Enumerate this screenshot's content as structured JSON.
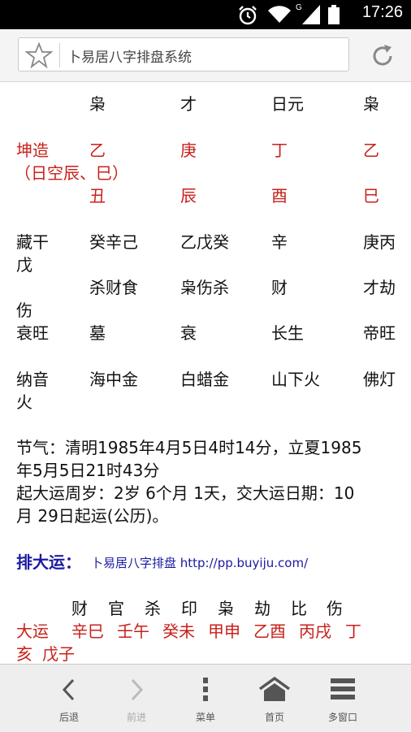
{
  "status_bar": {
    "time": "17:26",
    "network": "G"
  },
  "address_bar": {
    "page_title": "卜易居八字排盘系统"
  },
  "bazi": {
    "gods_row": [
      "枭",
      "才",
      "日元",
      "枭"
    ],
    "qiankun_label": "坤造",
    "kong_note": "（日空辰、巳）",
    "stems": [
      "乙",
      "庚",
      "丁",
      "乙"
    ],
    "branches": [
      "丑",
      "辰",
      "酉",
      "巳"
    ],
    "canggan": {
      "label_line1": "藏干",
      "values": [
        "癸辛己",
        "乙戊癸",
        "辛",
        "庚丙"
      ],
      "overflow": "戊"
    },
    "shishen": {
      "values": [
        "杀财食",
        "枭伤杀",
        "财",
        "才劫"
      ],
      "overflow": "伤"
    },
    "changsheng": {
      "label": "衰旺",
      "values": [
        "墓",
        "衰",
        "长生",
        "帝旺"
      ]
    },
    "nayin": {
      "label": "纳音",
      "values": [
        "海中金",
        "白蜡金",
        "山下火",
        "佛灯"
      ],
      "overflow": "火"
    }
  },
  "jieqi_line1": "节气：清明1985年4月5日4时14分，立夏1985",
  "jieqi_line2": "年5月5日21时43分",
  "qiyun_line1": "起大运周岁：2岁 6个月 1天，交大运日期：10",
  "qiyun_line2": "月 29日起运(公历)。",
  "dayun_heading": "排大运：",
  "dayun_link": "卜易居八字排盘 http://pp.buyiju.com/",
  "dayun_gods": [
    "财",
    "官",
    "杀",
    "印",
    "枭",
    "劫",
    "比",
    "伤"
  ],
  "dayun_label": "大运",
  "dayun_values": [
    "辛巳",
    "壬午",
    "癸未",
    "甲申",
    "乙酉",
    "丙戌",
    "丁"
  ],
  "dayun_overflow": [
    "亥",
    "戊子"
  ],
  "bottom_nav": [
    {
      "label": "后退",
      "icon": "back-icon",
      "enabled": true
    },
    {
      "label": "前进",
      "icon": "forward-icon",
      "enabled": false
    },
    {
      "label": "菜单",
      "icon": "menu-icon",
      "enabled": true
    },
    {
      "label": "首页",
      "icon": "home-icon",
      "enabled": true
    },
    {
      "label": "多窗口",
      "icon": "windows-icon",
      "enabled": true
    }
  ],
  "colors": {
    "red_text": "#c8201a",
    "blue_heading": "#1a1aa0"
  }
}
